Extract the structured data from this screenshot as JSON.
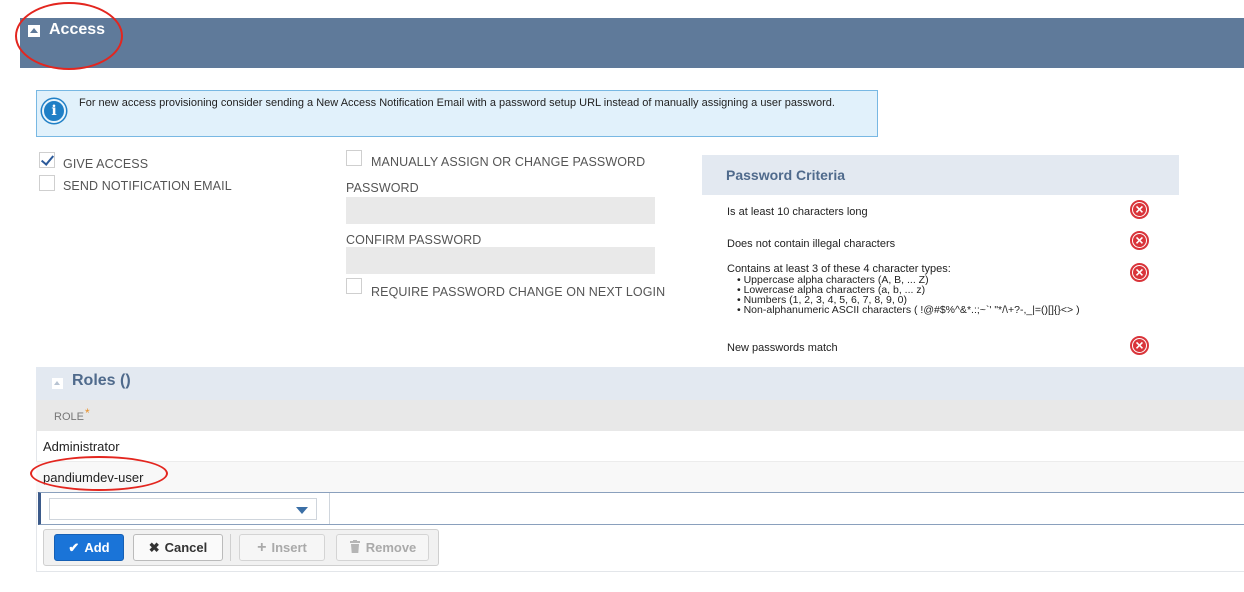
{
  "access": {
    "title": "Access"
  },
  "info_banner": {
    "text": "For new access provisioning consider sending a New Access Notification Email with a password setup URL instead of manually assigning a user password."
  },
  "options": {
    "give_access": {
      "label": "GIVE ACCESS",
      "checked": true
    },
    "send_notification": {
      "label": "SEND NOTIFICATION EMAIL",
      "checked": false
    },
    "manual_password": {
      "label": "MANUALLY ASSIGN OR CHANGE PASSWORD",
      "checked": false
    },
    "require_change": {
      "label": "REQUIRE PASSWORD CHANGE ON NEXT LOGIN",
      "checked": false
    }
  },
  "password_fields": {
    "password_label": "PASSWORD",
    "password_value": "",
    "confirm_label": "CONFIRM PASSWORD",
    "confirm_value": ""
  },
  "criteria": {
    "title": "Password Criteria",
    "items": [
      {
        "text": "Is at least 10 characters long",
        "status": "fail"
      },
      {
        "text": "Does not contain illegal characters",
        "status": "fail"
      },
      {
        "text": "Contains at least 3 of these 4 character types:",
        "status": "fail",
        "sub": [
          "• Uppercase alpha characters (A, B, ... Z)",
          "• Lowercase alpha characters (a, b, ... z)",
          "• Numbers (1, 2, 3, 4, 5, 6, 7, 8, 9, 0)",
          "• Non-alphanumeric ASCII characters ( !@#$%^&*.:;~`' \"*/\\+?-,_|=()[]{}<> )"
        ]
      },
      {
        "text": "New passwords match",
        "status": "fail"
      }
    ]
  },
  "roles": {
    "title": "Roles ()",
    "column_header": "ROLE",
    "required_marker": "*",
    "rows": [
      "Administrator",
      "pandiumdev-user"
    ],
    "select_value": ""
  },
  "toolbar": {
    "add": "Add",
    "cancel": "Cancel",
    "insert": "Insert",
    "remove": "Remove"
  },
  "colors": {
    "header_bg": "#5f7a9a",
    "accent": "#1a74d8",
    "error": "#d9343a",
    "annotation": "#e3261f"
  }
}
